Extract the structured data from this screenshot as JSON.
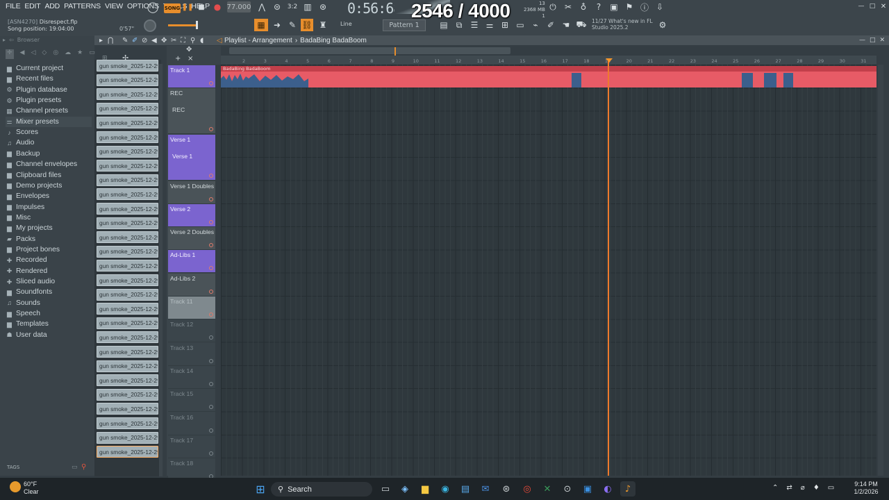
{
  "menu": [
    "FILE",
    "EDIT",
    "ADD",
    "PATTERNS",
    "VIEW",
    "OPTIONS",
    "TOOLS",
    "HELP"
  ],
  "transport": {
    "mode_badge": "SONG",
    "tempo": "77.000",
    "clock": "0:56:68",
    "clock_unit": "M:S:CS",
    "memory": "2368 MB",
    "mem_sub": "1",
    "cpu_top": "13"
  },
  "overlay_counter": "2546 / 4000",
  "hint": {
    "file": "[ASN4270]",
    "file_name": "Disrespect.flp",
    "position": "Song position: 19:04:00",
    "time": "0'57\""
  },
  "toolbar2": {
    "snap_mode": "Line",
    "pattern": "Pattern 1",
    "news_count": "11/27",
    "news_title": "What's new in FL",
    "news_sub": "Studio 2025.2"
  },
  "browser": {
    "header": "Browser",
    "items": [
      {
        "label": "Current project",
        "icon": "folder"
      },
      {
        "label": "Recent files",
        "icon": "folder"
      },
      {
        "label": "Plugin database",
        "icon": "plug"
      },
      {
        "label": "Plugin presets",
        "icon": "plug"
      },
      {
        "label": "Channel presets",
        "icon": "channel"
      },
      {
        "label": "Mixer presets",
        "icon": "mixer"
      },
      {
        "label": "Scores",
        "icon": "note"
      },
      {
        "label": "Audio",
        "icon": "speaker"
      },
      {
        "label": "Backup",
        "icon": "folder"
      },
      {
        "label": "Channel envelopes",
        "icon": "folder"
      },
      {
        "label": "Clipboard files",
        "icon": "folder"
      },
      {
        "label": "Demo projects",
        "icon": "folder"
      },
      {
        "label": "Envelopes",
        "icon": "folder"
      },
      {
        "label": "Impulses",
        "icon": "folder"
      },
      {
        "label": "Misc",
        "icon": "folder"
      },
      {
        "label": "My projects",
        "icon": "folder"
      },
      {
        "label": "Packs",
        "icon": "pack"
      },
      {
        "label": "Project bones",
        "icon": "folder"
      },
      {
        "label": "Recorded",
        "icon": "plus"
      },
      {
        "label": "Rendered",
        "icon": "plus"
      },
      {
        "label": "Sliced audio",
        "icon": "plus"
      },
      {
        "label": "Soundfonts",
        "icon": "folder"
      },
      {
        "label": "Sounds",
        "icon": "speaker"
      },
      {
        "label": "Speech",
        "icon": "folder"
      },
      {
        "label": "Templates",
        "icon": "folder"
      },
      {
        "label": "User data",
        "icon": "user"
      }
    ],
    "tags_label": "TAGS"
  },
  "channels": [
    "gun smoke_2025-12-29...",
    "gun smoke_2025-12-29...",
    "gun smoke_2025-12-29...",
    "gun smoke_2025-12-29...",
    "gun smoke_2025-12-29...",
    "gun smoke_2025-12-29...",
    "gun smoke_2025-12-29...",
    "gun smoke_2025-12-29...",
    "gun smoke_2025-12-29...",
    "gun smoke_2025-12-29...",
    "gun smoke_2025-12-29...",
    "gun smoke_2025-12-29...",
    "gun smoke_2025-12-29...",
    "gun smoke_2025-12-29...",
    "gun smoke_2025-12-29...",
    "gun smoke_2025-12-29...",
    "gun smoke_2025-12-29...",
    "gun smoke_2025-12-29...",
    "gun smoke_2025-12-29...",
    "gun smoke_2025-12-29...",
    "gun smoke_2025-12-29...",
    "gun smoke_2025-12-29...",
    "gun smoke_2025-12-29...",
    "gun smoke_2025-12-29...",
    "gun smoke_2025-12-29...",
    "gun smoke_2025-12-29...",
    "gun smoke_2025-12-29...",
    "gun smoke_2025-12-29..."
  ],
  "playlist": {
    "title": "Playlist - Arrangement",
    "pattern_name": "BadaBing BadaBoom",
    "clip_name": "BadaBing BadaBoom",
    "ruler": [
      "2",
      "3",
      "4",
      "5",
      "6",
      "7",
      "8",
      "9",
      "10",
      "11",
      "12",
      "13",
      "14",
      "15",
      "16",
      "17",
      "18",
      "19",
      "20",
      "21",
      "22",
      "23",
      "24",
      "25",
      "26",
      "27",
      "28",
      "29",
      "30",
      "31"
    ]
  },
  "tracks": [
    {
      "name": "Track 1",
      "sub": "",
      "style": "purple"
    },
    {
      "name": "REC",
      "sub": "REC",
      "style": "grey"
    },
    {
      "name": "Verse 1",
      "sub": "Verse 1",
      "style": "purple"
    },
    {
      "name": "Verse 1 Doubles",
      "sub": "",
      "style": "grey"
    },
    {
      "name": "Verse 2",
      "sub": "",
      "style": "purple"
    },
    {
      "name": "Verse 2 Doubles",
      "sub": "",
      "style": "grey"
    },
    {
      "name": "Ad-Libs 1",
      "sub": "",
      "style": "purple"
    },
    {
      "name": "Ad-Libs 2",
      "sub": "",
      "style": "grey"
    },
    {
      "name": "Track 11",
      "sub": "",
      "style": "light"
    },
    {
      "name": "Track 12",
      "sub": "",
      "style": "dim"
    },
    {
      "name": "Track 13",
      "sub": "",
      "style": "dim"
    },
    {
      "name": "Track 14",
      "sub": "",
      "style": "dim"
    },
    {
      "name": "Track 15",
      "sub": "",
      "style": "dim"
    },
    {
      "name": "Track 16",
      "sub": "",
      "style": "dim"
    },
    {
      "name": "Track 17",
      "sub": "",
      "style": "dim"
    },
    {
      "name": "Track 18",
      "sub": "",
      "style": "dim"
    }
  ],
  "taskbar": {
    "temp": "60°F",
    "weather": "Clear",
    "search": "Search",
    "time": "9:14 PM",
    "date": "1/2/2026"
  },
  "colors": {
    "accent": "#e88e2c",
    "clip": "#e75b66",
    "track_purple": "#7b64cf",
    "playhead": "#ef7a2c"
  }
}
